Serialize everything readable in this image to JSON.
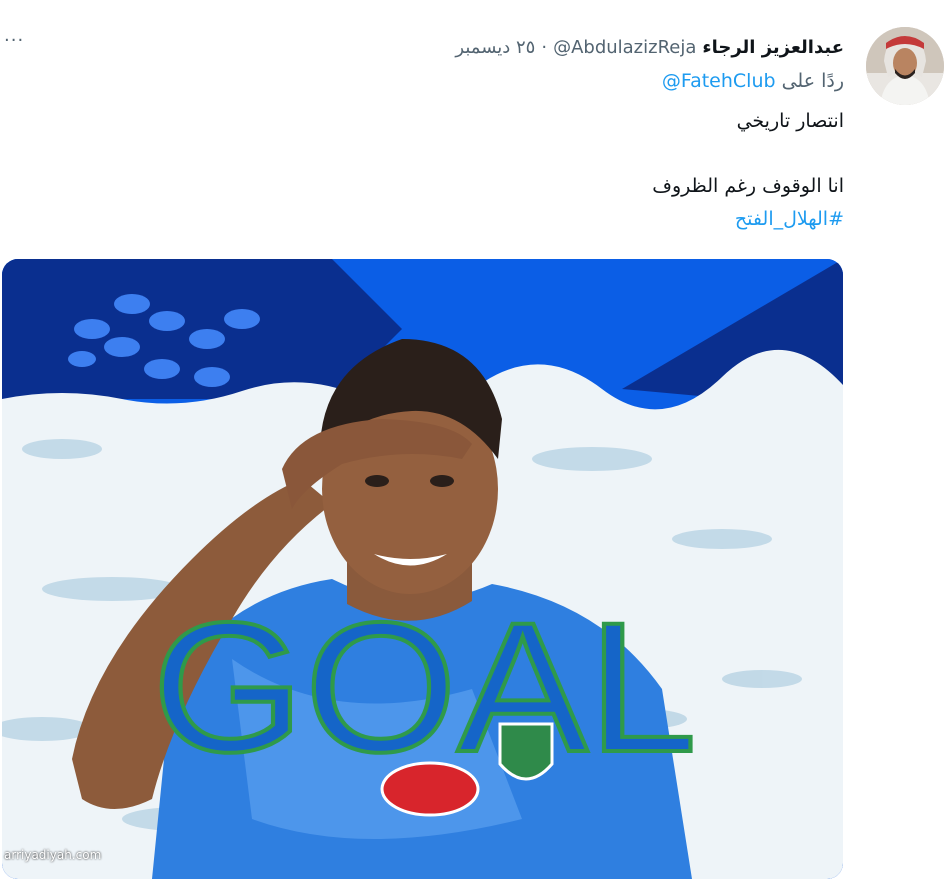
{
  "tweet": {
    "display_name": "عبدالعزيز الرجاء",
    "handle": "@AbdulazizReja",
    "separator": "·",
    "date": "٢٥ ديسمبر",
    "more_label": "···",
    "reply_prefix": "ردًا على",
    "reply_to": "@FatehClub",
    "line1": "انتصار تاريخي",
    "line2": "انا الوقوف رغم الظروف",
    "hashtag": "#الهلال_الفتح"
  },
  "media": {
    "overlay_text": "GOAL",
    "colors": {
      "deep_blue": "#0a36a8",
      "bright_blue": "#0b5ee6",
      "snow": "#eef4f8",
      "goal_fill": "#1565c8",
      "goal_outline": "#2f9a4a",
      "jersey": "#2f7fe0"
    }
  },
  "watermark": "arriyadiyah.com"
}
